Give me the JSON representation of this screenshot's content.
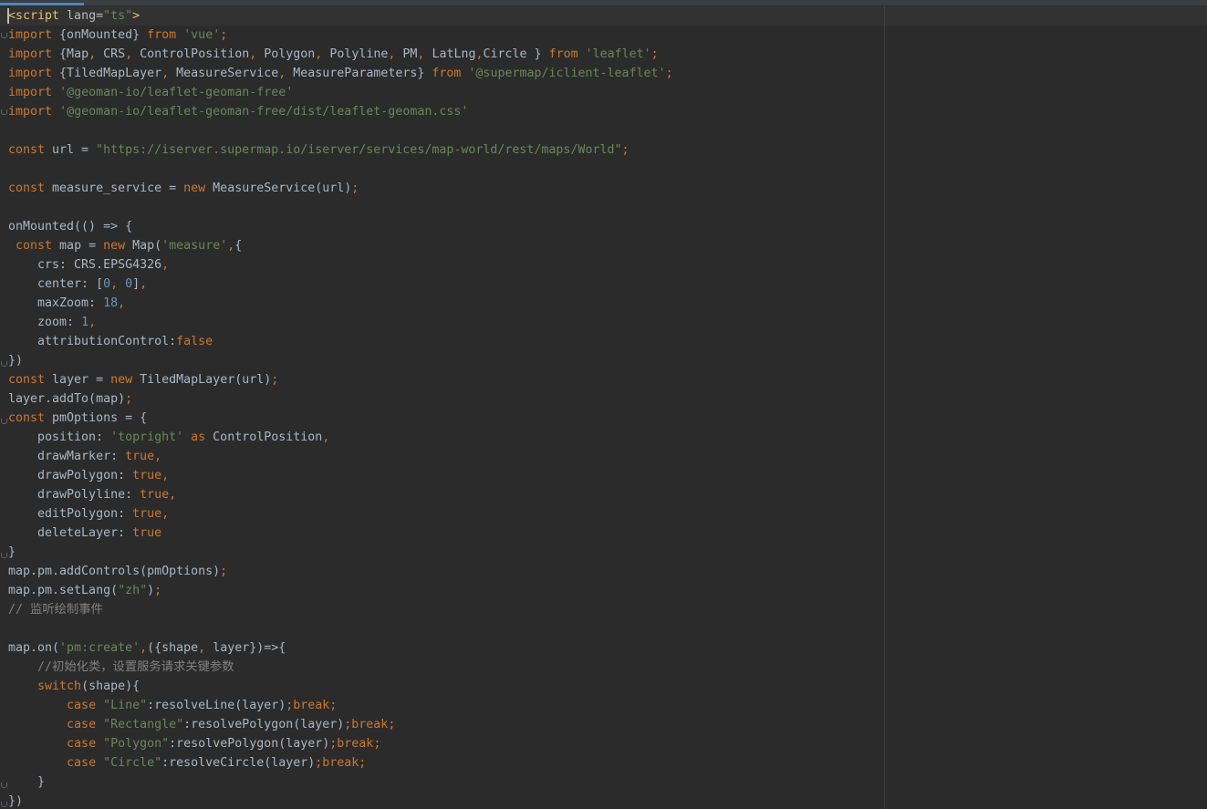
{
  "editor": {
    "language": "ts",
    "lines": [
      [
        {
          "t": "<script",
          "c": "tag"
        },
        {
          "t": " lang=",
          "c": "attr"
        },
        {
          "t": "\"ts\"",
          "c": "str"
        },
        {
          "t": ">",
          "c": "tag"
        }
      ],
      [
        {
          "t": "import",
          "c": "kw"
        },
        {
          "t": " {onMounted} ",
          "c": "plain"
        },
        {
          "t": "from",
          "c": "kw"
        },
        {
          "t": " ",
          "c": "plain"
        },
        {
          "t": "'vue'",
          "c": "str"
        },
        {
          "t": ";",
          "c": "kw"
        }
      ],
      [
        {
          "t": "import",
          "c": "kw"
        },
        {
          "t": " {Map",
          "c": "plain"
        },
        {
          "t": ",",
          "c": "kw"
        },
        {
          "t": " CRS",
          "c": "plain"
        },
        {
          "t": ",",
          "c": "kw"
        },
        {
          "t": " ControlPosition",
          "c": "plain"
        },
        {
          "t": ",",
          "c": "kw"
        },
        {
          "t": " Polygon",
          "c": "plain"
        },
        {
          "t": ",",
          "c": "kw"
        },
        {
          "t": " Polyline",
          "c": "plain"
        },
        {
          "t": ",",
          "c": "kw"
        },
        {
          "t": " PM",
          "c": "plain"
        },
        {
          "t": ",",
          "c": "kw"
        },
        {
          "t": " LatLng",
          "c": "plain"
        },
        {
          "t": ",",
          "c": "kw"
        },
        {
          "t": "Circle } ",
          "c": "plain"
        },
        {
          "t": "from",
          "c": "kw"
        },
        {
          "t": " ",
          "c": "plain"
        },
        {
          "t": "'leaflet'",
          "c": "str"
        },
        {
          "t": ";",
          "c": "kw"
        }
      ],
      [
        {
          "t": "import",
          "c": "kw"
        },
        {
          "t": " {TiledMapLayer",
          "c": "plain"
        },
        {
          "t": ",",
          "c": "kw"
        },
        {
          "t": " MeasureService",
          "c": "plain"
        },
        {
          "t": ",",
          "c": "kw"
        },
        {
          "t": " MeasureParameters} ",
          "c": "plain"
        },
        {
          "t": "from",
          "c": "kw"
        },
        {
          "t": " ",
          "c": "plain"
        },
        {
          "t": "'@supermap/iclient-leaflet'",
          "c": "str"
        },
        {
          "t": ";",
          "c": "kw"
        }
      ],
      [
        {
          "t": "import",
          "c": "kw"
        },
        {
          "t": " ",
          "c": "plain"
        },
        {
          "t": "'@geoman-io/leaflet-geoman-free'",
          "c": "str"
        }
      ],
      [
        {
          "t": "import",
          "c": "kw"
        },
        {
          "t": " ",
          "c": "plain"
        },
        {
          "t": "'@geoman-io/leaflet-geoman-free/dist/leaflet-geoman.css'",
          "c": "str"
        }
      ],
      [],
      [
        {
          "t": "const",
          "c": "kw"
        },
        {
          "t": " url = ",
          "c": "plain"
        },
        {
          "t": "\"https://iserver.supermap.io/iserver/services/map-world/rest/maps/World\"",
          "c": "str"
        },
        {
          "t": ";",
          "c": "kw"
        }
      ],
      [],
      [
        {
          "t": "const",
          "c": "kw"
        },
        {
          "t": " measure_service = ",
          "c": "plain"
        },
        {
          "t": "new",
          "c": "kw"
        },
        {
          "t": " MeasureService(url)",
          "c": "plain"
        },
        {
          "t": ";",
          "c": "kw"
        }
      ],
      [],
      [
        {
          "t": "onMounted(() => {",
          "c": "plain"
        }
      ],
      [
        {
          "t": " ",
          "c": "plain"
        },
        {
          "t": "const",
          "c": "kw"
        },
        {
          "t": " map = ",
          "c": "plain"
        },
        {
          "t": "new",
          "c": "kw"
        },
        {
          "t": " Map(",
          "c": "plain"
        },
        {
          "t": "'measure'",
          "c": "str"
        },
        {
          "t": ",",
          "c": "kw"
        },
        {
          "t": "{",
          "c": "plain"
        }
      ],
      [
        {
          "t": "    crs: CRS.EPSG4326",
          "c": "plain"
        },
        {
          "t": ",",
          "c": "kw"
        }
      ],
      [
        {
          "t": "    center: [",
          "c": "plain"
        },
        {
          "t": "0",
          "c": "num"
        },
        {
          "t": ",",
          "c": "kw"
        },
        {
          "t": " ",
          "c": "plain"
        },
        {
          "t": "0",
          "c": "num"
        },
        {
          "t": "]",
          "c": "plain"
        },
        {
          "t": ",",
          "c": "kw"
        }
      ],
      [
        {
          "t": "    maxZoom: ",
          "c": "plain"
        },
        {
          "t": "18",
          "c": "num"
        },
        {
          "t": ",",
          "c": "kw"
        }
      ],
      [
        {
          "t": "    zoom: ",
          "c": "plain"
        },
        {
          "t": "1",
          "c": "num"
        },
        {
          "t": ",",
          "c": "kw"
        }
      ],
      [
        {
          "t": "    attributionControl:",
          "c": "plain"
        },
        {
          "t": "false",
          "c": "kw"
        }
      ],
      [
        {
          "t": "})",
          "c": "plain"
        }
      ],
      [
        {
          "t": "const",
          "c": "kw"
        },
        {
          "t": " layer = ",
          "c": "plain"
        },
        {
          "t": "new",
          "c": "kw"
        },
        {
          "t": " TiledMapLayer(url)",
          "c": "plain"
        },
        {
          "t": ";",
          "c": "kw"
        }
      ],
      [
        {
          "t": "layer.addTo(map)",
          "c": "plain"
        },
        {
          "t": ";",
          "c": "kw"
        }
      ],
      [
        {
          "t": "const",
          "c": "kw"
        },
        {
          "t": " pmOptions = {",
          "c": "plain"
        }
      ],
      [
        {
          "t": "    position: ",
          "c": "plain"
        },
        {
          "t": "'topright'",
          "c": "str"
        },
        {
          "t": " ",
          "c": "plain"
        },
        {
          "t": "as",
          "c": "kw"
        },
        {
          "t": " ControlPosition",
          "c": "plain"
        },
        {
          "t": ",",
          "c": "kw"
        }
      ],
      [
        {
          "t": "    drawMarker: ",
          "c": "plain"
        },
        {
          "t": "true",
          "c": "kw"
        },
        {
          "t": ",",
          "c": "kw"
        }
      ],
      [
        {
          "t": "    drawPolygon: ",
          "c": "plain"
        },
        {
          "t": "true",
          "c": "kw"
        },
        {
          "t": ",",
          "c": "kw"
        }
      ],
      [
        {
          "t": "    drawPolyline: ",
          "c": "plain"
        },
        {
          "t": "true",
          "c": "kw"
        },
        {
          "t": ",",
          "c": "kw"
        }
      ],
      [
        {
          "t": "    editPolygon: ",
          "c": "plain"
        },
        {
          "t": "true",
          "c": "kw"
        },
        {
          "t": ",",
          "c": "kw"
        }
      ],
      [
        {
          "t": "    deleteLayer: ",
          "c": "plain"
        },
        {
          "t": "true",
          "c": "kw"
        }
      ],
      [
        {
          "t": "}",
          "c": "plain"
        }
      ],
      [
        {
          "t": "map.pm.addControls(pmOptions)",
          "c": "plain"
        },
        {
          "t": ";",
          "c": "kw"
        }
      ],
      [
        {
          "t": "map.pm.setLang(",
          "c": "plain"
        },
        {
          "t": "\"zh\"",
          "c": "str"
        },
        {
          "t": ")",
          "c": "plain"
        },
        {
          "t": ";",
          "c": "kw"
        }
      ],
      [
        {
          "t": "// 监听绘制事件",
          "c": "com"
        }
      ],
      [],
      [
        {
          "t": "map.on(",
          "c": "plain"
        },
        {
          "t": "'pm:create'",
          "c": "str"
        },
        {
          "t": ",",
          "c": "kw"
        },
        {
          "t": "({shape",
          "c": "plain"
        },
        {
          "t": ",",
          "c": "kw"
        },
        {
          "t": " layer})=>{",
          "c": "plain"
        }
      ],
      [
        {
          "t": "    //初始化类，设置服务请求关键参数",
          "c": "com"
        }
      ],
      [
        {
          "t": "    ",
          "c": "plain"
        },
        {
          "t": "switch",
          "c": "kw"
        },
        {
          "t": "(shape){",
          "c": "plain"
        }
      ],
      [
        {
          "t": "        ",
          "c": "plain"
        },
        {
          "t": "case",
          "c": "kw"
        },
        {
          "t": " ",
          "c": "plain"
        },
        {
          "t": "\"Line\"",
          "c": "str"
        },
        {
          "t": ":resolveLine(layer)",
          "c": "plain"
        },
        {
          "t": ";break;",
          "c": "kw"
        }
      ],
      [
        {
          "t": "        ",
          "c": "plain"
        },
        {
          "t": "case",
          "c": "kw"
        },
        {
          "t": " ",
          "c": "plain"
        },
        {
          "t": "\"Rectangle\"",
          "c": "str"
        },
        {
          "t": ":resolvePolygon(layer)",
          "c": "plain"
        },
        {
          "t": ";break;",
          "c": "kw"
        }
      ],
      [
        {
          "t": "        ",
          "c": "plain"
        },
        {
          "t": "case",
          "c": "kw"
        },
        {
          "t": " ",
          "c": "plain"
        },
        {
          "t": "\"Polygon\"",
          "c": "str"
        },
        {
          "t": ":resolvePolygon(layer)",
          "c": "plain"
        },
        {
          "t": ";break;",
          "c": "kw"
        }
      ],
      [
        {
          "t": "        ",
          "c": "plain"
        },
        {
          "t": "case",
          "c": "kw"
        },
        {
          "t": " ",
          "c": "plain"
        },
        {
          "t": "\"Circle\"",
          "c": "str"
        },
        {
          "t": ":resolveCircle(layer)",
          "c": "plain"
        },
        {
          "t": ";break;",
          "c": "kw"
        }
      ],
      [
        {
          "t": "    }",
          "c": "plain"
        }
      ],
      [
        {
          "t": "})",
          "c": "plain"
        }
      ]
    ],
    "colors": {
      "background": "#2b2b2b",
      "keyword": "#cc7832",
      "string": "#6a8759",
      "number": "#6897bb",
      "comment": "#808080",
      "tag": "#e8bf6a",
      "plain": "#a9b7c6",
      "tab_accent": "#4a88c7"
    }
  }
}
